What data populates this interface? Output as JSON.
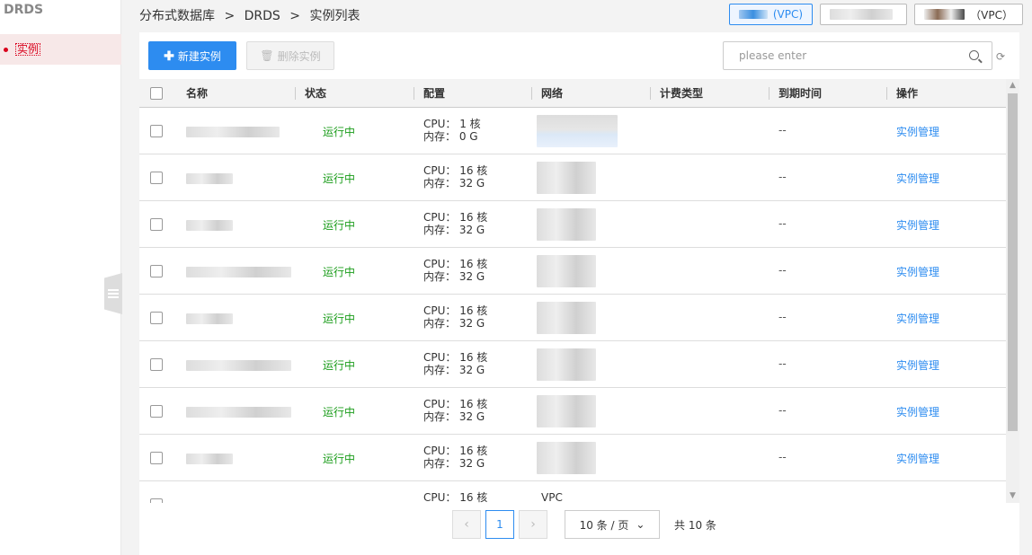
{
  "sidebar": {
    "brand": "DRDS",
    "items": [
      {
        "label": "实例"
      }
    ]
  },
  "breadcrumb": [
    "分布式数据库",
    ">",
    "DRDS",
    ">",
    "实例列表"
  ],
  "regions": [
    {
      "suffix": "(VPC)",
      "active": true
    },
    {
      "suffix": "",
      "active": false
    },
    {
      "suffix": "（VPC）",
      "active": false
    }
  ],
  "toolbar": {
    "create_label": "新建实例",
    "delete_label": "删除实例",
    "search_placeholder": "please enter"
  },
  "table": {
    "columns": [
      "名称",
      "状态",
      "配置",
      "网络",
      "计费类型",
      "到期时间",
      "操作"
    ],
    "rows": [
      {
        "status": "运行中",
        "cpu": "CPU：  1 核",
        "mem": "内存：  0 G",
        "expire": "--",
        "action": "实例管理"
      },
      {
        "status": "运行中",
        "cpu": "CPU：  16 核",
        "mem": "内存：  32 G",
        "expire": "--",
        "action": "实例管理"
      },
      {
        "status": "运行中",
        "cpu": "CPU：  16 核",
        "mem": "内存：  32 G",
        "expire": "--",
        "action": "实例管理"
      },
      {
        "status": "运行中",
        "cpu": "CPU：  16 核",
        "mem": "内存：  32 G",
        "expire": "--",
        "action": "实例管理"
      },
      {
        "status": "运行中",
        "cpu": "CPU：  16 核",
        "mem": "内存：  32 G",
        "expire": "--",
        "action": "实例管理"
      },
      {
        "status": "运行中",
        "cpu": "CPU：  16 核",
        "mem": "内存：  32 G",
        "expire": "--",
        "action": "实例管理"
      },
      {
        "status": "运行中",
        "cpu": "CPU：  16 核",
        "mem": "内存：  32 G",
        "expire": "--",
        "action": "实例管理"
      },
      {
        "status": "运行中",
        "cpu": "CPU：  16 核",
        "mem": "内存：  32 G",
        "expire": "--",
        "action": "实例管理"
      },
      {
        "status": "",
        "cpu": "CPU：  16 核",
        "mem": "",
        "net": "VPC",
        "expire": "",
        "action": ""
      }
    ]
  },
  "pagination": {
    "prev": "‹",
    "current_page": "1",
    "next": "›",
    "page_size": "10 条 / 页",
    "total": "共 10 条"
  },
  "colors": {
    "primary": "#2d8cf0",
    "running": "#1a9c1a",
    "sidebar_active": "#d9001b"
  }
}
